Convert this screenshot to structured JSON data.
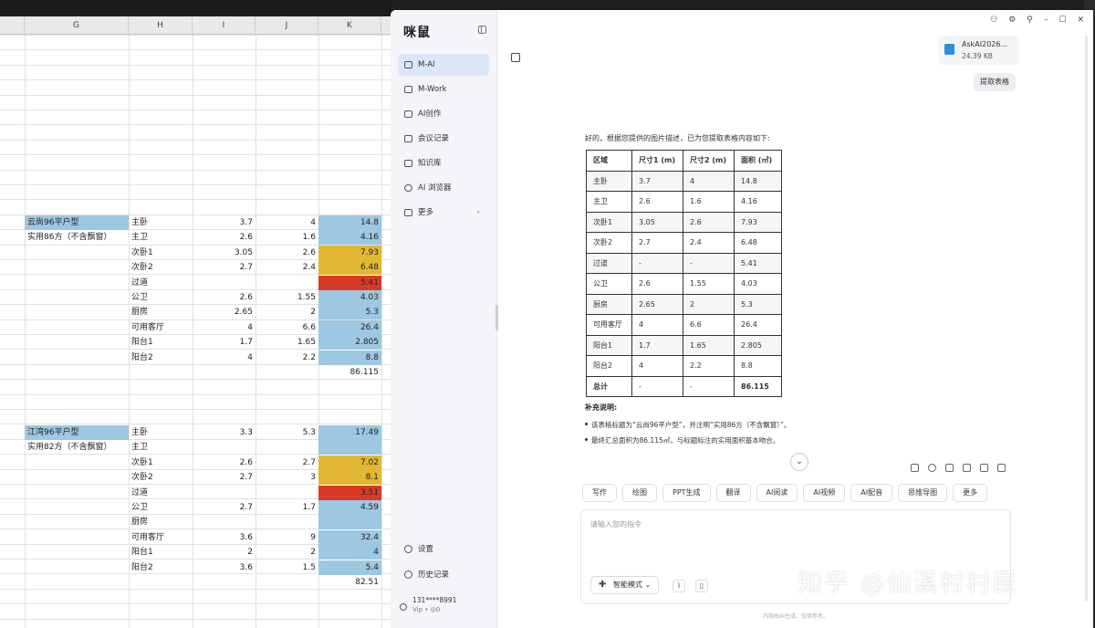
{
  "sheet": {
    "columns": [
      "G",
      "H",
      "I",
      "J",
      "K"
    ],
    "block1": {
      "title": "云尚96平户型",
      "subtitle": "实用86方（不含飘窗）",
      "rows": [
        {
          "name": "主卧",
          "a": "3.7",
          "b": "4",
          "area": "14.8",
          "color": "blue"
        },
        {
          "name": "主卫",
          "a": "2.6",
          "b": "1.6",
          "area": "4.16",
          "color": "blue"
        },
        {
          "name": "次卧1",
          "a": "3.05",
          "b": "2.6",
          "area": "7.93",
          "color": "yellow"
        },
        {
          "name": "次卧2",
          "a": "2.7",
          "b": "2.4",
          "area": "6.48",
          "color": "yellow"
        },
        {
          "name": "过道",
          "a": "",
          "b": "",
          "area": "5.41",
          "color": "red"
        },
        {
          "name": "公卫",
          "a": "2.6",
          "b": "1.55",
          "area": "4.03",
          "color": "blue"
        },
        {
          "name": "厨房",
          "a": "2.65",
          "b": "2",
          "area": "5.3",
          "color": "blue"
        },
        {
          "name": "可用客厅",
          "a": "4",
          "b": "6.6",
          "area": "26.4",
          "color": "blue"
        },
        {
          "name": "阳台1",
          "a": "1.7",
          "b": "1.65",
          "area": "2.805",
          "color": "blue"
        },
        {
          "name": "阳台2",
          "a": "4",
          "b": "2.2",
          "area": "8.8",
          "color": "blue"
        }
      ],
      "total": "86.115"
    },
    "block2": {
      "title": "江湾96平户型",
      "subtitle": "实用82方（不含飘窗）",
      "rows": [
        {
          "name": "主卧",
          "a": "3.3",
          "b": "5.3",
          "area": "17.49",
          "color": "blue"
        },
        {
          "name": "主卫",
          "a": "",
          "b": "",
          "area": "",
          "color": "blue"
        },
        {
          "name": "次卧1",
          "a": "2.6",
          "b": "2.7",
          "area": "7.02",
          "color": "yellow"
        },
        {
          "name": "次卧2",
          "a": "2.7",
          "b": "3",
          "area": "8.1",
          "color": "yellow"
        },
        {
          "name": "过道",
          "a": "",
          "b": "",
          "area": "3.51",
          "color": "red"
        },
        {
          "name": "公卫",
          "a": "2.7",
          "b": "1.7",
          "area": "4.59",
          "color": "blue"
        },
        {
          "name": "厨房",
          "a": "",
          "b": "",
          "area": "",
          "color": "blue"
        },
        {
          "name": "可用客厅",
          "a": "3.6",
          "b": "9",
          "area": "32.4",
          "color": "blue"
        },
        {
          "name": "阳台1",
          "a": "2",
          "b": "2",
          "area": "4",
          "color": "blue"
        },
        {
          "name": "阳台2",
          "a": "3.6",
          "b": "1.5",
          "area": "5.4",
          "color": "blue"
        }
      ],
      "total": "82.51"
    }
  },
  "app": {
    "logo": "咪鼠",
    "nav": [
      {
        "label": "M-AI",
        "icon": "chat-icon",
        "active": true
      },
      {
        "label": "M-Work",
        "icon": "work-icon"
      },
      {
        "label": "AI创作",
        "icon": "image-icon"
      },
      {
        "label": "会议记录",
        "icon": "meeting-icon"
      },
      {
        "label": "知识库",
        "icon": "book-icon"
      },
      {
        "label": "AI 浏览器",
        "icon": "compass-icon"
      },
      {
        "label": "更多",
        "icon": "grid-icon"
      }
    ],
    "settings": "设置",
    "history": "历史记录",
    "user": {
      "phone": "131****8991",
      "level": "Vip",
      "points": "0"
    },
    "file": {
      "name": "AskAI2026...",
      "size": "24.39 KB"
    },
    "user_message": "提取表格",
    "reply_intro": "好的，根据您提供的图片描述，已为您提取表格内容如下:",
    "table": {
      "headers": [
        "区域",
        "尺寸1 (m)",
        "尺寸2 (m)",
        "面积 (㎡)"
      ],
      "rows": [
        [
          "主卧",
          "3.7",
          "4",
          "14.8"
        ],
        [
          "主卫",
          "2.6",
          "1.6",
          "4.16"
        ],
        [
          "次卧1",
          "3.05",
          "2.6",
          "7.93"
        ],
        [
          "次卧2",
          "2.7",
          "2.4",
          "6.48"
        ],
        [
          "过道",
          "-",
          "-",
          "5.41"
        ],
        [
          "公卫",
          "2.6",
          "1.55",
          "4.03"
        ],
        [
          "厨房",
          "2.65",
          "2",
          "5.3"
        ],
        [
          "可用客厅",
          "4",
          "6.6",
          "26.4"
        ],
        [
          "阳台1",
          "1.7",
          "1.65",
          "2.805"
        ],
        [
          "阳台2",
          "4",
          "2.2",
          "8.8"
        ]
      ],
      "total": [
        "总计",
        "-",
        "-",
        "86.115"
      ]
    },
    "note_title": "补充说明:",
    "notes": [
      "该表格标题为“云尚96平户型”，并注明“实用86方（不含飘窗）”。",
      "最终汇总面积为86.115㎡，与标题标注的实用面积基本吻合。"
    ],
    "chips": [
      "写作",
      "绘图",
      "PPT生成",
      "翻译",
      "AI阅读",
      "AI视频",
      "AI配音",
      "思维导图",
      "更多"
    ],
    "input_placeholder": "请输入您的指令",
    "mode": "智能模式",
    "disclaimer": "内容由AI生成，仅供参考。"
  },
  "watermark": "知乎 @仙溪村村民"
}
